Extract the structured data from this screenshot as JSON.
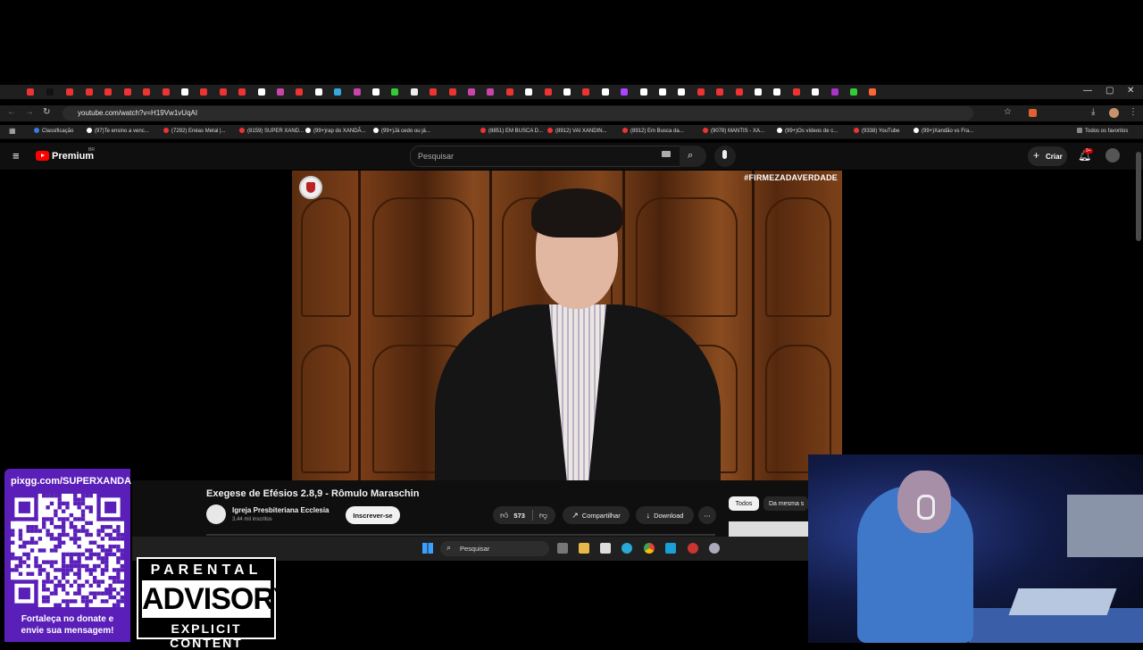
{
  "browser": {
    "url": "youtube.com/watch?v=H19Vw1vUqAI",
    "bookmarks": [
      "Classificação",
      "(97)Te ensino a venc...",
      "(7292) Enéas Metal |...",
      "(8159) SUPER XAND...",
      "(99+)rap do XANDÃ...",
      "(99+)Já cedo ou já...",
      "(8851) EM BUSCA D...",
      "(8912) VAI XANDIN...",
      "(8912) Em Busca da...",
      "(9078) MANTIS - XA...",
      "(99+)Os vídeos de c...",
      "(9338) YouTube",
      "(99+)Xandão vs Fra..."
    ],
    "all_bookmarks": "Todos os favoritos",
    "colors": {
      "chrome": "#1f1f1f",
      "youtube_red": "#ff0000"
    }
  },
  "youtube": {
    "logo_text": "Premium",
    "logo_sup": "BR",
    "search_placeholder": "Pesquisar",
    "create_label": "Criar",
    "notif_count": "9+",
    "video_overlay_tag": "#FIRMEZADAVERDADE",
    "video_title": "Exegese de Efésios 2.8,9 - Rômulo Maraschin",
    "channel_name": "Igreja Presbiteriana Ecclesia",
    "channel_subs": "3,44 mil inscritos",
    "subscribe_label": "Inscrever-se",
    "likes": "573",
    "share_label": "Compartilhar",
    "download_label": "Download",
    "chips": [
      "Todos",
      "Da mesma s"
    ]
  },
  "taskbar": {
    "search_placeholder": "Pesquisar"
  },
  "overlay": {
    "donate_url": "pixgg.com/SUPERXANDA",
    "donate_message_1": "Fortaleça no donate e",
    "donate_message_2": "envie sua mensagem!",
    "advisory_line1": "PARENTAL",
    "advisory_line2": "ADVISORY",
    "advisory_line3": "EXPLICIT CONTENT"
  }
}
